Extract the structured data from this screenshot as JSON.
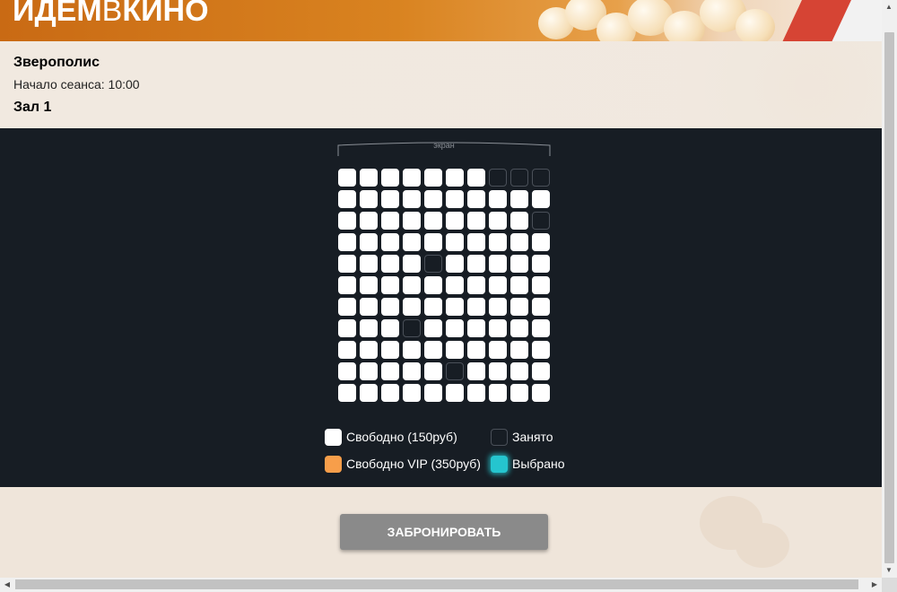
{
  "header": {
    "logo_left": "Идем",
    "logo_mid": "в",
    "logo_right": "кино"
  },
  "info": {
    "movie_title": "Зверополис",
    "session_time": "Начало сеанса: 10:00",
    "hall_name": "Зал 1"
  },
  "hall": {
    "screen_label": "экран",
    "seats": [
      [
        "free",
        "free",
        "free",
        "free",
        "free",
        "free",
        "free",
        "taken",
        "taken",
        "taken"
      ],
      [
        "free",
        "free",
        "free",
        "free",
        "free",
        "free",
        "free",
        "free",
        "free",
        "free"
      ],
      [
        "free",
        "free",
        "free",
        "free",
        "free",
        "free",
        "free",
        "free",
        "free",
        "taken"
      ],
      [
        "free",
        "free",
        "free",
        "free",
        "free",
        "free",
        "free",
        "free",
        "free",
        "free"
      ],
      [
        "free",
        "free",
        "free",
        "free",
        "taken",
        "free",
        "free",
        "free",
        "free",
        "free"
      ],
      [
        "free",
        "free",
        "free",
        "free",
        "free",
        "free",
        "free",
        "free",
        "free",
        "free"
      ],
      [
        "free",
        "free",
        "free",
        "free",
        "free",
        "free",
        "free",
        "free",
        "free",
        "free"
      ],
      [
        "free",
        "free",
        "free",
        "taken",
        "free",
        "free",
        "free",
        "free",
        "free",
        "free"
      ],
      [
        "free",
        "free",
        "free",
        "free",
        "free",
        "free",
        "free",
        "free",
        "free",
        "free"
      ],
      [
        "free",
        "free",
        "free",
        "free",
        "free",
        "taken",
        "free",
        "free",
        "free",
        "free"
      ],
      [
        "free",
        "free",
        "free",
        "free",
        "free",
        "free",
        "free",
        "free",
        "free",
        "free"
      ]
    ],
    "legend": {
      "free": "Свободно (150руб)",
      "taken": "Занято",
      "vip": "Свободно VIP (350руб)",
      "selected": "Выбрано"
    }
  },
  "colors": {
    "free": "#ffffff",
    "vip": "#f79e4a",
    "taken": "#171d24",
    "selected": "#25c5cf",
    "hall_bg": "#171d24",
    "button": "#8a8a8a"
  },
  "actions": {
    "book_label": "Забронировать"
  }
}
